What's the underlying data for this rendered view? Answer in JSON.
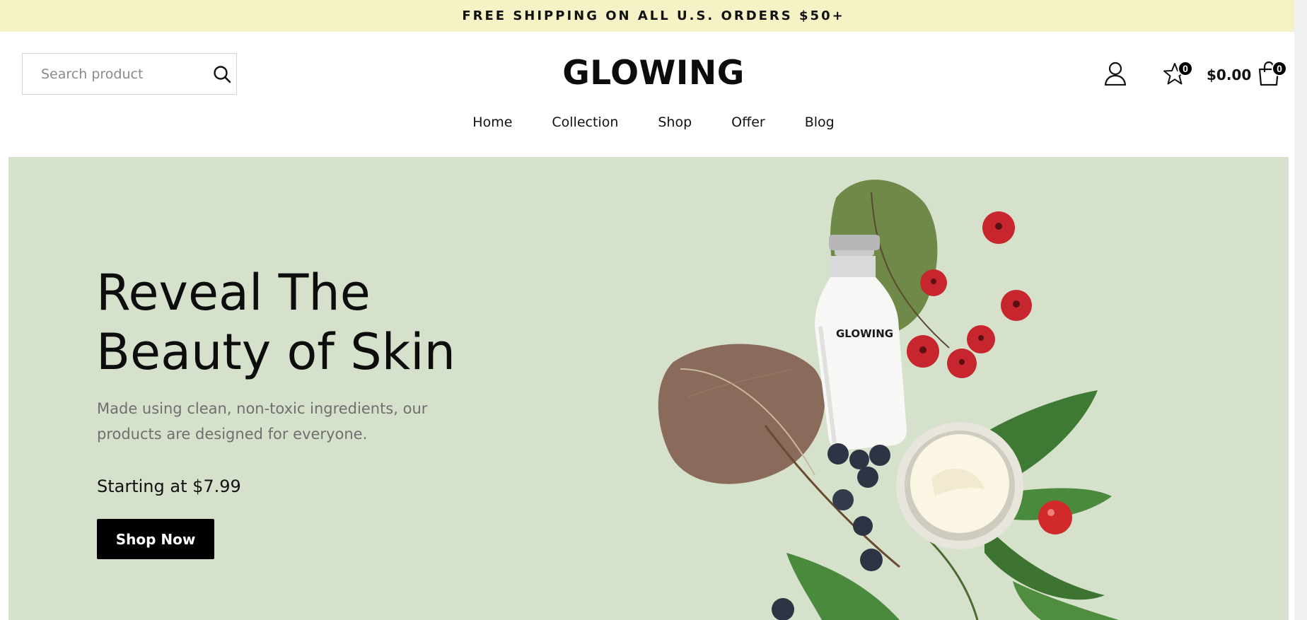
{
  "announcement": "FREE SHIPPING ON ALL U.S. ORDERS $50+",
  "search": {
    "placeholder": "Search product",
    "value": ""
  },
  "brand": "GLOWING",
  "header": {
    "wishlist_count": "0",
    "cart_total": "$0.00",
    "cart_count": "0"
  },
  "nav": [
    "Home",
    "Collection",
    "Shop",
    "Offer",
    "Blog"
  ],
  "hero": {
    "title_line1": "Reveal The",
    "title_line2": "Beauty of Skin",
    "description": "Made using clean, non-toxic ingredients, our products are designed for everyone.",
    "price_text": "Starting at $7.99",
    "cta": "Shop Now",
    "bottle_label": "GLOWING"
  },
  "colors": {
    "announcement_bg": "#f5f3c6",
    "hero_bg": "#d6e1cc",
    "button_bg": "#000000"
  },
  "icons": [
    "search-icon",
    "user-icon",
    "star-icon",
    "shopping-bag-icon"
  ]
}
